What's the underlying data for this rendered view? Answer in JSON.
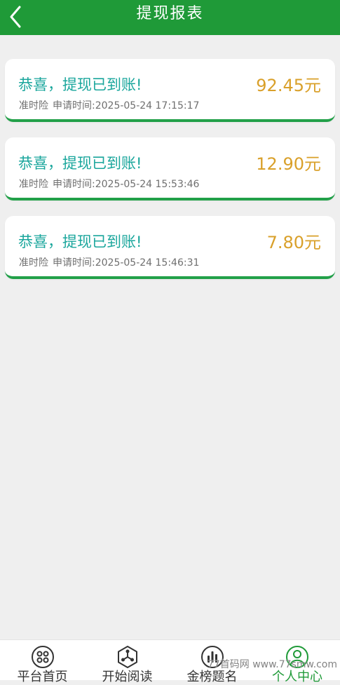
{
  "header": {
    "title": "提现报表",
    "back_icon": "chevron-left-icon"
  },
  "records": [
    {
      "title": "恭喜，提现已到账!",
      "amount": "92.45元",
      "source": "准时险",
      "apply_time": "申请时间:2025-05-24 17:15:17"
    },
    {
      "title": "恭喜，提现已到账!",
      "amount": "12.90元",
      "source": "准时险",
      "apply_time": "申请时间:2025-05-24 15:53:46"
    },
    {
      "title": "恭喜，提现已到账!",
      "amount": "7.80元",
      "source": "准时险",
      "apply_time": "申请时间:2025-05-24 15:46:31"
    }
  ],
  "tabbar": {
    "items": [
      {
        "label": "平台首页",
        "icon": "grid-circle-icon",
        "active": false
      },
      {
        "label": "开始阅读",
        "icon": "hexagon-network-icon",
        "active": false
      },
      {
        "label": "金榜题名",
        "icon": "bar-chart-circle-icon",
        "active": false
      },
      {
        "label": "个人中心",
        "icon": "user-circle-icon",
        "active": true
      }
    ]
  },
  "watermark": "77首码网 www.77smw.com",
  "colors": {
    "header_bg": "#1f9a38",
    "page_bg": "#efefef",
    "title_text": "#1aa69c",
    "amount_text": "#d9a02a",
    "card_border": "#22a049",
    "active_tab": "#1f9a38"
  }
}
